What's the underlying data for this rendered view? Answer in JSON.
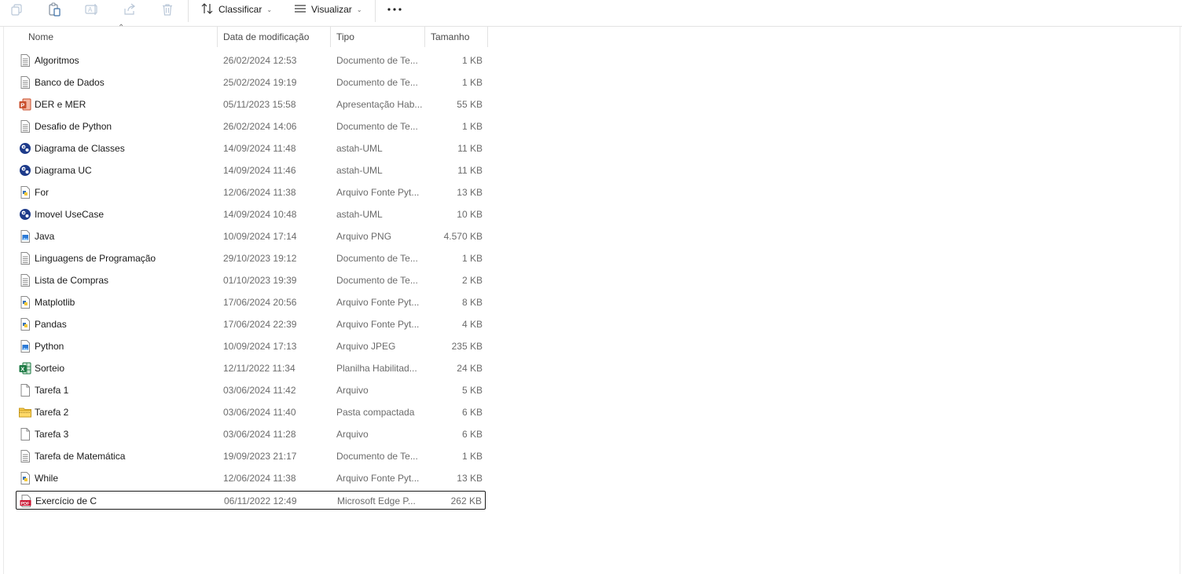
{
  "toolbar": {
    "sort_label": "Classificar",
    "view_label": "Visualizar"
  },
  "columns": {
    "name": "Nome",
    "date": "Data de modificação",
    "type": "Tipo",
    "size": "Tamanho"
  },
  "files": [
    {
      "name": "Algoritmos",
      "date": "26/02/2024 12:53",
      "type": "Documento de Te...",
      "size": "1 KB",
      "icon": "text-document-icon"
    },
    {
      "name": "Banco de Dados",
      "date": "25/02/2024 19:19",
      "type": "Documento de Te...",
      "size": "1 KB",
      "icon": "text-document-icon"
    },
    {
      "name": "DER e MER",
      "date": "05/11/2023 15:58",
      "type": "Apresentação Hab...",
      "size": "55 KB",
      "icon": "powerpoint-icon"
    },
    {
      "name": "Desafio de Python",
      "date": "26/02/2024 14:06",
      "type": "Documento de Te...",
      "size": "1 KB",
      "icon": "text-document-icon"
    },
    {
      "name": "Diagrama de Classes",
      "date": "14/09/2024 11:48",
      "type": "astah-UML",
      "size": "11 KB",
      "icon": "astah-icon"
    },
    {
      "name": "Diagrama UC",
      "date": "14/09/2024 11:46",
      "type": "astah-UML",
      "size": "11 KB",
      "icon": "astah-icon"
    },
    {
      "name": "For",
      "date": "12/06/2024 11:38",
      "type": "Arquivo Fonte Pyt...",
      "size": "13 KB",
      "icon": "python-file-icon"
    },
    {
      "name": "Imovel UseCase",
      "date": "14/09/2024 10:48",
      "type": "astah-UML",
      "size": "10 KB",
      "icon": "astah-icon"
    },
    {
      "name": "Java",
      "date": "10/09/2024 17:14",
      "type": "Arquivo PNG",
      "size": "4.570 KB",
      "icon": "image-file-icon"
    },
    {
      "name": "Linguagens de Programação",
      "date": "29/10/2023 19:12",
      "type": "Documento de Te...",
      "size": "1 KB",
      "icon": "text-document-icon"
    },
    {
      "name": "Lista de Compras",
      "date": "01/10/2023 19:39",
      "type": "Documento de Te...",
      "size": "2 KB",
      "icon": "text-document-icon"
    },
    {
      "name": "Matplotlib",
      "date": "17/06/2024 20:56",
      "type": "Arquivo Fonte Pyt...",
      "size": "8 KB",
      "icon": "python-file-icon"
    },
    {
      "name": "Pandas",
      "date": "17/06/2024 22:39",
      "type": "Arquivo Fonte Pyt...",
      "size": "4 KB",
      "icon": "python-file-icon"
    },
    {
      "name": "Python",
      "date": "10/09/2024 17:13",
      "type": "Arquivo JPEG",
      "size": "235 KB",
      "icon": "image-file-icon"
    },
    {
      "name": "Sorteio",
      "date": "12/11/2022 11:34",
      "type": "Planilha Habilitad...",
      "size": "24 KB",
      "icon": "excel-icon"
    },
    {
      "name": "Tarefa 1",
      "date": "03/06/2024 11:42",
      "type": "Arquivo",
      "size": "5 KB",
      "icon": "blank-file-icon"
    },
    {
      "name": "Tarefa 2",
      "date": "03/06/2024 11:40",
      "type": "Pasta compactada",
      "size": "6 KB",
      "icon": "zip-folder-icon"
    },
    {
      "name": "Tarefa 3",
      "date": "03/06/2024 11:28",
      "type": "Arquivo",
      "size": "6 KB",
      "icon": "blank-file-icon"
    },
    {
      "name": "Tarefa de Matemática",
      "date": "19/09/2023 21:17",
      "type": "Documento de Te...",
      "size": "1 KB",
      "icon": "text-document-icon"
    },
    {
      "name": "While",
      "date": "12/06/2024 11:38",
      "type": "Arquivo Fonte Pyt...",
      "size": "13 KB",
      "icon": "python-file-icon"
    },
    {
      "name": "Exercício de C",
      "date": "06/11/2022 12:49",
      "type": "Microsoft Edge P...",
      "size": "262 KB",
      "icon": "pdf-icon",
      "selected": true
    }
  ]
}
